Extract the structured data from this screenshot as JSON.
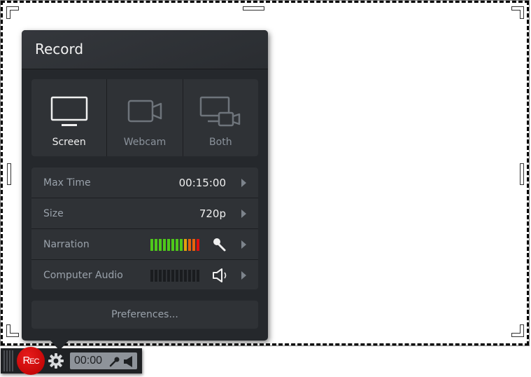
{
  "panel": {
    "title": "Record",
    "sources": [
      {
        "label": "Screen",
        "icon": "monitor-icon",
        "active": true
      },
      {
        "label": "Webcam",
        "icon": "webcam-icon",
        "active": false
      },
      {
        "label": "Both",
        "icon": "screen-and-webcam-icon",
        "active": false
      }
    ],
    "settings": {
      "max_time": {
        "label": "Max Time",
        "value": "00:15:00"
      },
      "size": {
        "label": "Size",
        "value": "720p"
      },
      "narration": {
        "label": "Narration",
        "icon": "microphone-icon",
        "level_segments_lit": 12,
        "level_segments_total": 12
      },
      "computer_audio": {
        "label": "Computer Audio",
        "icon": "speaker-icon",
        "level_segments_lit": 0,
        "level_segments_total": 12
      }
    },
    "preferences_label": "Preferences..."
  },
  "toolbar": {
    "rec_label_big": "R",
    "rec_label_small": "EC",
    "timer": "00:00",
    "icons": [
      "grip-icon",
      "gear-icon",
      "microphone-icon",
      "speaker-icon"
    ]
  },
  "colors": {
    "meter_green": "#4fc81a",
    "meter_yellow": "#e3a10c",
    "meter_orange": "#e8620c",
    "meter_red": "#e01010",
    "meter_off": "#1a1c1f",
    "rec_red": "#d10000"
  }
}
